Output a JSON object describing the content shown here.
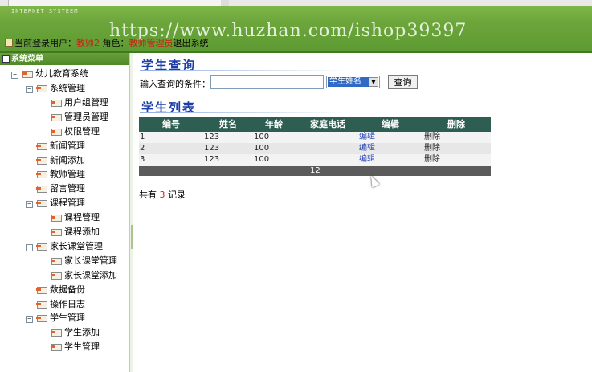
{
  "header": {
    "system_caption": "INTERNET SYSTEEM",
    "watermark": "https://www.huzhan.com/ishop39397",
    "current_user_label": "当前登录用户：",
    "current_user": "教师2",
    "role_label": "角色：",
    "role": "教师管理员",
    "logout": "退出系统"
  },
  "sidebar": {
    "title": "系统菜单",
    "root": "幼儿教育系统",
    "items": [
      {
        "label": "系统管理",
        "level": 1,
        "expander": "−"
      },
      {
        "label": "用户组管理",
        "level": 2
      },
      {
        "label": "管理员管理",
        "level": 2
      },
      {
        "label": "权限管理",
        "level": 2
      },
      {
        "label": "新闻管理",
        "level": 1
      },
      {
        "label": "新闻添加",
        "level": 1
      },
      {
        "label": "教师管理",
        "level": 1
      },
      {
        "label": "留言管理",
        "level": 1
      },
      {
        "label": "课程管理",
        "level": 1,
        "expander": "−"
      },
      {
        "label": "课程管理",
        "level": 2
      },
      {
        "label": "课程添加",
        "level": 2
      },
      {
        "label": "家长课堂管理",
        "level": 1,
        "expander": "−"
      },
      {
        "label": "家长课堂管理",
        "level": 2
      },
      {
        "label": "家长课堂添加",
        "level": 2
      },
      {
        "label": "数据备份",
        "level": 1
      },
      {
        "label": "操作日志",
        "level": 1
      },
      {
        "label": "学生管理",
        "level": 1,
        "expander": "−"
      },
      {
        "label": "学生添加",
        "level": 2
      },
      {
        "label": "学生管理",
        "level": 2
      }
    ]
  },
  "query": {
    "title": "学生查询",
    "label": "输入查询的条件：",
    "input_value": "",
    "field_selected": "学生姓名",
    "button": "查询"
  },
  "list": {
    "title": "学生列表",
    "columns": [
      "编号",
      "姓名",
      "年龄",
      "家庭电话",
      "编辑",
      "删除"
    ],
    "rows": [
      {
        "id": "1",
        "name": "123",
        "age": "100",
        "phone": "",
        "edit": "编辑",
        "delete": "删除"
      },
      {
        "id": "2",
        "name": "123",
        "age": "100",
        "phone": "",
        "edit": "编辑",
        "delete": "删除"
      },
      {
        "id": "3",
        "name": "123",
        "age": "100",
        "phone": "",
        "edit": "编辑",
        "delete": "删除"
      }
    ],
    "pager": "12",
    "total_prefix": "共有",
    "total_count": "3",
    "total_suffix": "记录"
  },
  "colors": {
    "header_green": "#6ca63b",
    "table_header": "#2e5e51",
    "title_blue": "#1d3ea8",
    "accent_red": "#cc1f13"
  }
}
